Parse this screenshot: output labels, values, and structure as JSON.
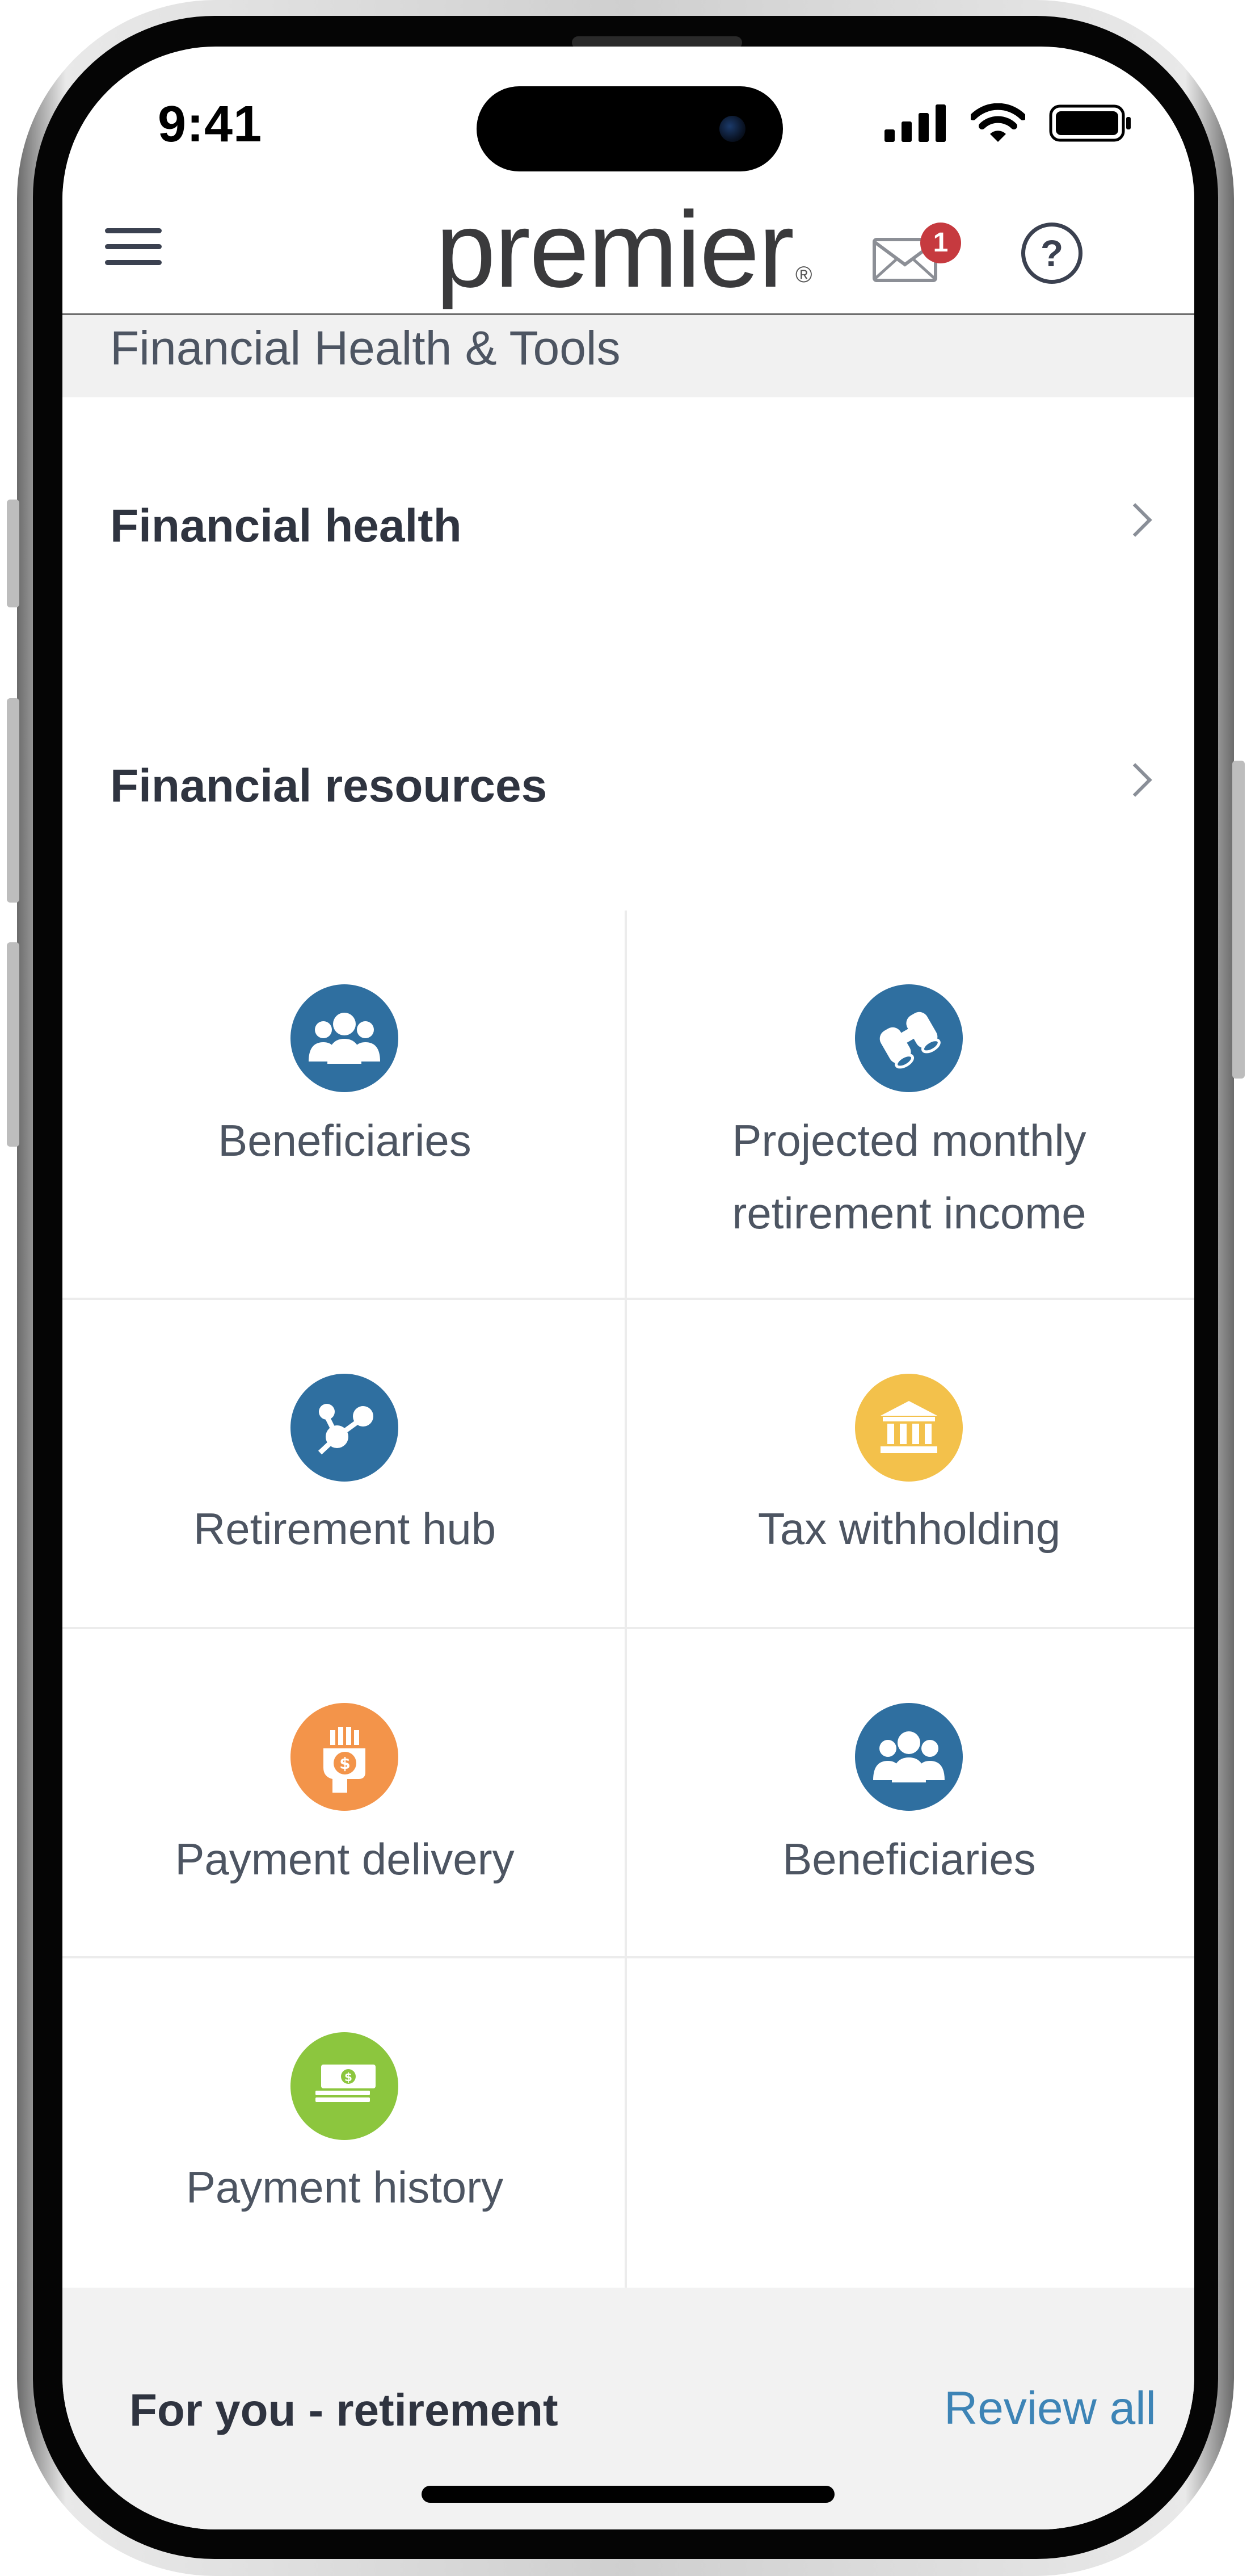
{
  "status_bar": {
    "time": "9:41"
  },
  "header": {
    "logo_text": "premier",
    "logo_mark": "®",
    "mail_badge_count": "1",
    "help_symbol": "?",
    "icons": [
      "hamburger-icon",
      "mail-icon",
      "help-icon"
    ]
  },
  "section": {
    "heading": "Financial Health & Tools"
  },
  "list": [
    {
      "label": "Financial health"
    },
    {
      "label": "Financial resources"
    }
  ],
  "tiles": [
    {
      "label_line1": "Beneficiaries",
      "label_line2": "",
      "icon": "people-group-icon",
      "color": "#2f6fa0"
    },
    {
      "label_line1": "Projected monthly",
      "label_line2": "retirement income",
      "icon": "binoculars-icon",
      "color": "#2f6fa0"
    },
    {
      "label_line1": "Retirement hub",
      "label_line2": "",
      "icon": "network-hub-icon",
      "color": "#2f6fa0"
    },
    {
      "label_line1": "Tax withholding",
      "label_line2": "",
      "icon": "bank-building-icon",
      "color": "#f3c14b"
    },
    {
      "label_line1": "Payment delivery",
      "label_line2": "",
      "icon": "hand-coin-icon",
      "color": "#f3944a"
    },
    {
      "label_line1": "Beneficiaries",
      "label_line2": "",
      "icon": "people-group-icon",
      "color": "#2f6fa0"
    },
    {
      "label_line1": "Payment history",
      "label_line2": "",
      "icon": "cash-stack-icon",
      "color": "#8cc63e"
    }
  ],
  "bottom": {
    "title": "For you - retirement",
    "link": "Review all"
  }
}
